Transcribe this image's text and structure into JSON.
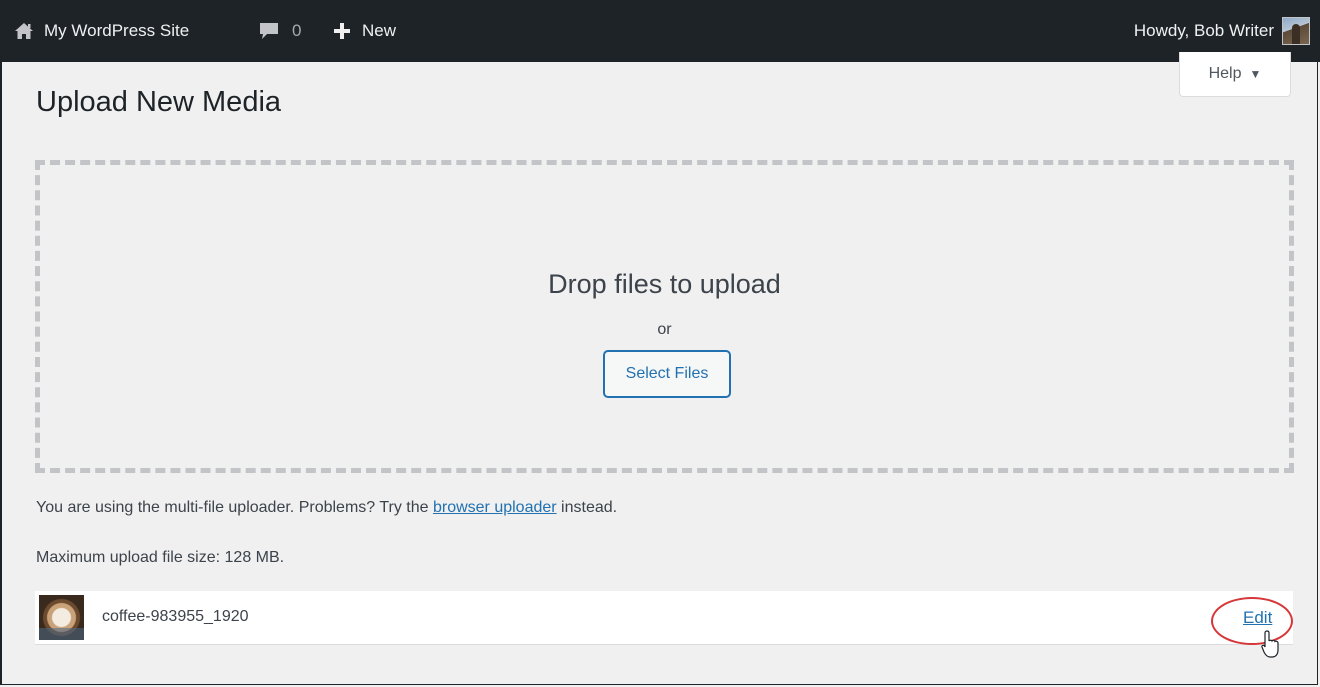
{
  "adminbar": {
    "site_name": "My WordPress Site",
    "comments_count": "0",
    "new_label": "New",
    "greeting": "Howdy, Bob Writer",
    "icons": {
      "site": "home-icon",
      "comments": "comment-bubble-icon",
      "new": "plus-icon",
      "avatar": "user-avatar"
    }
  },
  "help": {
    "label": "Help",
    "caret": "▼"
  },
  "page": {
    "title": "Upload New Media"
  },
  "uploader": {
    "drop_title": "Drop files to upload",
    "or_text": "or",
    "select_button": "Select Files",
    "info_prefix": "You are using the multi-file uploader. Problems? Try the",
    "browser_uploader_link": "browser uploader",
    "info_suffix": "instead.",
    "max_size": "Maximum upload file size: 128 MB."
  },
  "media_item": {
    "filename": "coffee-983955_1920",
    "edit_label": "Edit"
  },
  "colors": {
    "adminbar_bg": "#1d2327",
    "link": "#2271b1",
    "page_bg": "#f0f0f1",
    "highlight": "#d63638"
  }
}
